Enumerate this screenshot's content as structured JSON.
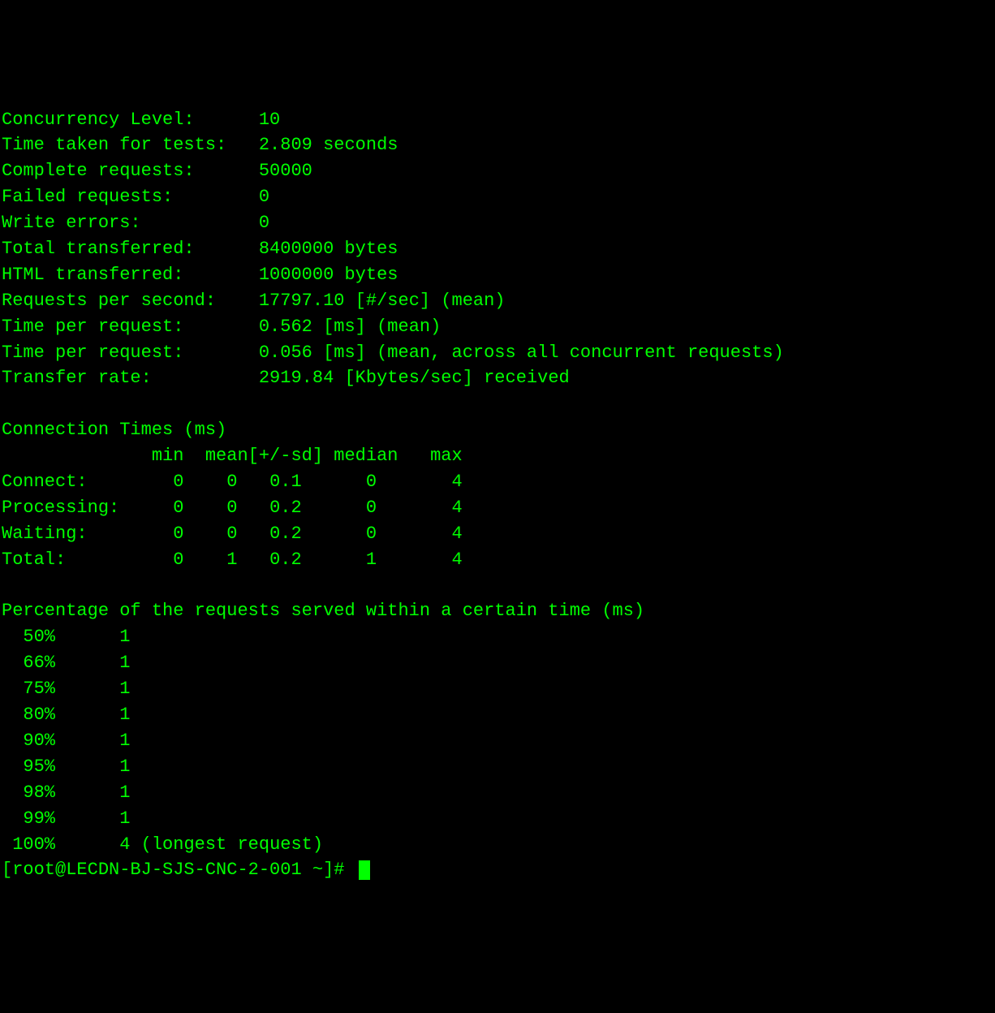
{
  "stats": [
    {
      "label": "Concurrency Level:      ",
      "value": "10"
    },
    {
      "label": "Time taken for tests:   ",
      "value": "2.809 seconds"
    },
    {
      "label": "Complete requests:      ",
      "value": "50000"
    },
    {
      "label": "Failed requests:        ",
      "value": "0"
    },
    {
      "label": "Write errors:           ",
      "value": "0"
    },
    {
      "label": "Total transferred:      ",
      "value": "8400000 bytes"
    },
    {
      "label": "HTML transferred:       ",
      "value": "1000000 bytes"
    },
    {
      "label": "Requests per second:    ",
      "value": "17797.10 [#/sec] (mean)"
    },
    {
      "label": "Time per request:       ",
      "value": "0.562 [ms] (mean)"
    },
    {
      "label": "Time per request:       ",
      "value": "0.056 [ms] (mean, across all concurrent requests)"
    },
    {
      "label": "Transfer rate:          ",
      "value": "2919.84 [Kbytes/sec] received"
    }
  ],
  "connection_times": {
    "title": "Connection Times (ms)",
    "header": "              min  mean[+/-sd] median   max",
    "rows": [
      {
        "label": "Connect:    ",
        "min": "    0",
        "mean": "    0",
        "sd": "   0.1",
        "median": "      0",
        "max": "       4"
      },
      {
        "label": "Processing: ",
        "min": "    0",
        "mean": "    0",
        "sd": "   0.2",
        "median": "      0",
        "max": "       4"
      },
      {
        "label": "Waiting:    ",
        "min": "    0",
        "mean": "    0",
        "sd": "   0.2",
        "median": "      0",
        "max": "       4"
      },
      {
        "label": "Total:      ",
        "min": "    0",
        "mean": "    1",
        "sd": "   0.2",
        "median": "      1",
        "max": "       4"
      }
    ]
  },
  "percentiles": {
    "title": "Percentage of the requests served within a certain time (ms)",
    "rows": [
      {
        "pct": "  50%",
        "val": "      1",
        "extra": ""
      },
      {
        "pct": "  66%",
        "val": "      1",
        "extra": ""
      },
      {
        "pct": "  75%",
        "val": "      1",
        "extra": ""
      },
      {
        "pct": "  80%",
        "val": "      1",
        "extra": ""
      },
      {
        "pct": "  90%",
        "val": "      1",
        "extra": ""
      },
      {
        "pct": "  95%",
        "val": "      1",
        "extra": ""
      },
      {
        "pct": "  98%",
        "val": "      1",
        "extra": ""
      },
      {
        "pct": "  99%",
        "val": "      1",
        "extra": ""
      },
      {
        "pct": " 100%",
        "val": "      4",
        "extra": " (longest request)"
      }
    ]
  },
  "prompt": "[root@LECDN-BJ-SJS-CNC-2-001 ~]# "
}
